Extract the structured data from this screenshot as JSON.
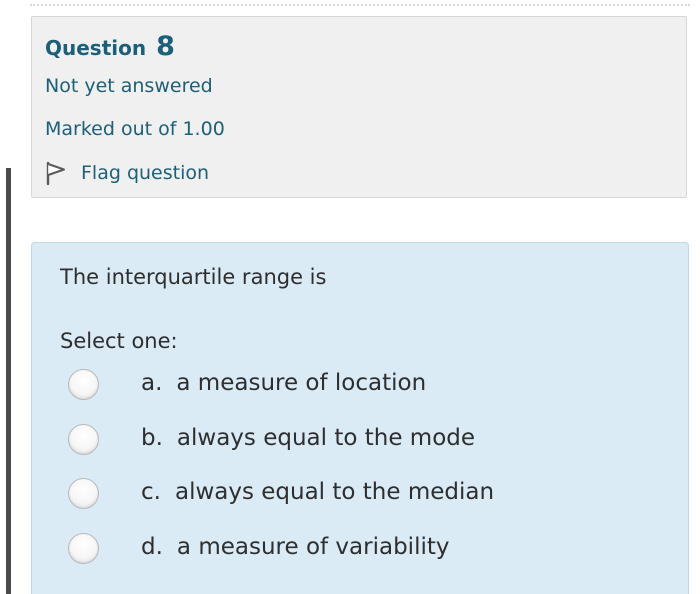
{
  "question_info": {
    "label": "Question",
    "number": "8",
    "state": "Not yet answered",
    "grade": "Marked out of 1.00",
    "flag_label": "Flag question",
    "flag_icon": "flag-outline-icon"
  },
  "question": {
    "text": "The interquartile range is",
    "prompt": "Select one:",
    "options": [
      {
        "letter": "a.",
        "text": "a measure of location"
      },
      {
        "letter": "b.",
        "text": "always equal to the mode"
      },
      {
        "letter": "c.",
        "text": "always equal to the median"
      },
      {
        "letter": "d.",
        "text": "a measure of variability"
      }
    ]
  },
  "colors": {
    "info_text": "#1b5f78",
    "info_background": "#f0f0f0",
    "content_background": "#dbebf6",
    "body_text": "#2e2e2e"
  }
}
